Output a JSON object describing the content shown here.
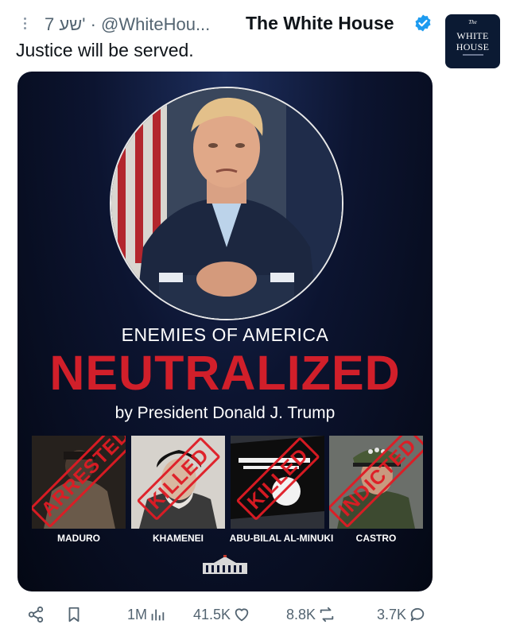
{
  "tweet": {
    "time_ago": "7 שע'",
    "handle": "@WhiteHou...",
    "separator": "·",
    "author_name": "The White House",
    "text": "Justice will be served.",
    "avatar": {
      "top": "The",
      "line1": "WHITE",
      "line2": "HOUSE"
    }
  },
  "media": {
    "kicker": "ENEMIES OF AMERICA",
    "headline": "NEUTRALIZED",
    "byline": "by President Donald J. Trump",
    "tiles": [
      {
        "stamp": "ARRESTED",
        "caption": "MADURO"
      },
      {
        "stamp": "KILLED",
        "caption": "KHAMENEI"
      },
      {
        "stamp": "KILLED",
        "caption": "ABU-BILAL AL-MINUKI"
      },
      {
        "stamp": "INDICTED",
        "caption": "CASTRO"
      }
    ]
  },
  "actions": {
    "views": "1M",
    "likes": "41.5K",
    "reposts": "8.8K",
    "replies": "3.7K"
  },
  "colors": {
    "accent_red": "#d11f2a",
    "verified_blue": "#1d9bf0",
    "muted": "#536471"
  },
  "icons": [
    "more-icon",
    "verified-icon",
    "share-icon",
    "bookmark-icon",
    "views-icon",
    "like-icon",
    "repost-icon",
    "reply-icon"
  ]
}
